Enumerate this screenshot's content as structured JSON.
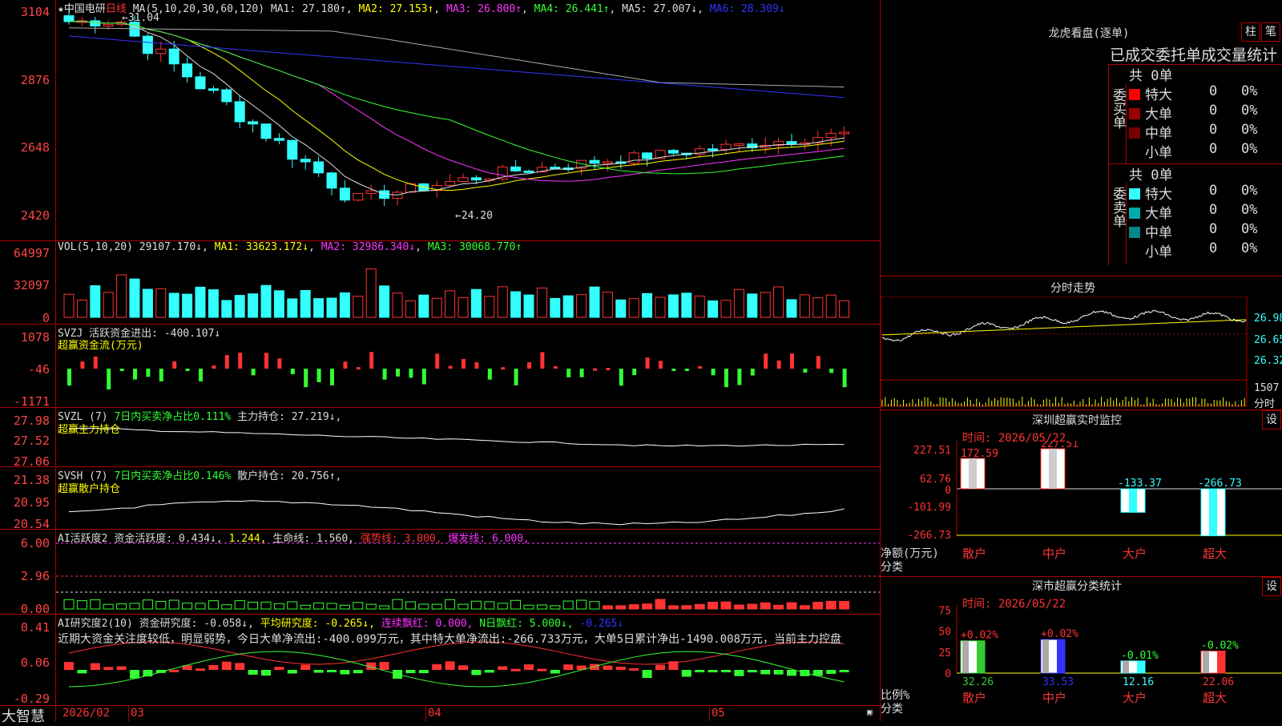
{
  "app": {
    "name": "大智慧",
    "stock": "中国电研",
    "period": "日线"
  },
  "main": {
    "ma_label": "MA(5,10,20,30,60,120)",
    "ma1": "MA1: 27.180↑",
    "ma2": "MA2: 27.153↑",
    "ma3": "MA3: 26.800↑",
    "ma4": "MA4: 26.441↑",
    "ma5": "MA5: 27.007↓",
    "ma6": "MA6: 28.309↓",
    "y_labels": [
      "3104",
      "2876",
      "2648",
      "2420"
    ],
    "high_mark": "31.04",
    "low_mark": "24.20"
  },
  "vol": {
    "label": "VOL(5,10,20)",
    "value": "29107.170↓",
    "ma1": "MA1: 33623.172↓",
    "ma2": "MA2: 32986.340↓",
    "ma3": "MA3: 30068.770↑",
    "y_labels": [
      "64997",
      "32097",
      "0"
    ]
  },
  "svzj": {
    "label": "SVZJ  活跃资金进出: -400.107↓",
    "sub": "超赢资金流(万元)",
    "y_labels": [
      "1078",
      "-46",
      "-1171"
    ]
  },
  "svzl": {
    "label": "SVZL (7)",
    "desc": "7日内买卖净占比0.111%",
    "hold": "主力持仓: 27.219↓,",
    "sub": "超赢主力持仓",
    "y_labels": [
      "27.98",
      "27.52",
      "27.06"
    ]
  },
  "svsh": {
    "label": "SVSH (7)",
    "desc": "7日内买卖净占比0.146%",
    "hold": "散户持仓: 20.756↑,",
    "sub": "超赢散户持仓",
    "y_labels": [
      "21.38",
      "20.95",
      "20.54"
    ]
  },
  "ai_active": {
    "label": "AI活跃度2",
    "a": "资金活跃度: 0.434↓,",
    "b": "1.244,",
    "c": "生命线: 1.560,",
    "d": "强势线: 3.000,",
    "e": "爆发线: 6.000,",
    "y_labels": [
      "6.00",
      "2.96",
      "0.00"
    ]
  },
  "ai_research": {
    "label": "AI研究度2(10)",
    "a": "资金研究度: -0.058↓,",
    "b": "平均研究度: -0.265↓,",
    "c": "连续飘红: 0.000,",
    "d": "N日飘红: 5.000↓,",
    "e": "-0.265↓",
    "comment": "近期大资金关注度较低，明显弱势，今日大单净流出:-400.099万元，其中特大单净流出:-266.733万元，大单5日累计净出-1490.008万元，当前主力控盘",
    "y_labels": [
      "0.41",
      "0.06",
      "-0.29"
    ]
  },
  "xaxis": {
    "labels": [
      "2026/02",
      "03",
      "04",
      "05"
    ]
  },
  "dragon": {
    "title": "龙虎看盘(逐单)",
    "btn1": "柱",
    "btn2": "笔",
    "header": "已成交委托单成交量统计",
    "buy": {
      "side": "委买单",
      "total": "共 0单",
      "rows": [
        {
          "name": "特大",
          "count": "0",
          "pct": "0%",
          "color": "#f00"
        },
        {
          "name": "大单",
          "count": "0",
          "pct": "0%",
          "color": "#900"
        },
        {
          "name": "中单",
          "count": "0",
          "pct": "0%",
          "color": "#700"
        },
        {
          "name": "小单",
          "count": "0",
          "pct": "0%",
          "color": "#000"
        }
      ]
    },
    "sell": {
      "side": "委卖单",
      "total": "共 0单",
      "rows": [
        {
          "name": "特大",
          "count": "0",
          "pct": "0%",
          "color": "#3ff"
        },
        {
          "name": "大单",
          "count": "0",
          "pct": "0%",
          "color": "#0aa"
        },
        {
          "name": "中单",
          "count": "0",
          "pct": "0%",
          "color": "#088"
        },
        {
          "name": "小单",
          "count": "0",
          "pct": "0%",
          "color": "#000"
        }
      ]
    }
  },
  "intraday": {
    "title": "分时走势",
    "y_labels": [
      "26.98",
      "26.65",
      "26.32"
    ],
    "vol_label": "1507",
    "time_label": "分时"
  },
  "monitor": {
    "title": "深圳超赢实时监控",
    "btn": "设",
    "time": "时间: 2026/05/22",
    "y_labels": [
      "227.51",
      "62.76",
      "0",
      "-101.99",
      "-266.73"
    ],
    "axis_title": "净额(万元)",
    "axis_sub": "分类",
    "bars": [
      {
        "name": "散户",
        "value": "172.59",
        "v": 172.59
      },
      {
        "name": "中户",
        "value": "227.51",
        "v": 227.51
      },
      {
        "name": "大户",
        "value": "-133.37",
        "v": -133.37
      },
      {
        "name": "超大",
        "value": "-266.73",
        "v": -266.73
      }
    ]
  },
  "category": {
    "title": "深市超赢分类统计",
    "btn": "设",
    "time": "时间: 2026/05/22",
    "y_labels": [
      "75",
      "50",
      "25",
      "0"
    ],
    "axis_title": "比例%",
    "axis_sub": "分类",
    "bars": [
      {
        "name": "散户",
        "pct": "32.26",
        "change": "+0.02%",
        "v": 32.26,
        "color": "#3c3"
      },
      {
        "name": "中户",
        "pct": "33.53",
        "change": "+0.02%",
        "v": 33.53,
        "color": "#33f"
      },
      {
        "name": "大户",
        "pct": "12.16",
        "change": "-0.01%",
        "v": 12.16,
        "color": "#3ff"
      },
      {
        "name": "超大",
        "pct": "22.06",
        "change": "-0.02%",
        "v": 22.06,
        "color": "#f33"
      }
    ]
  }
}
